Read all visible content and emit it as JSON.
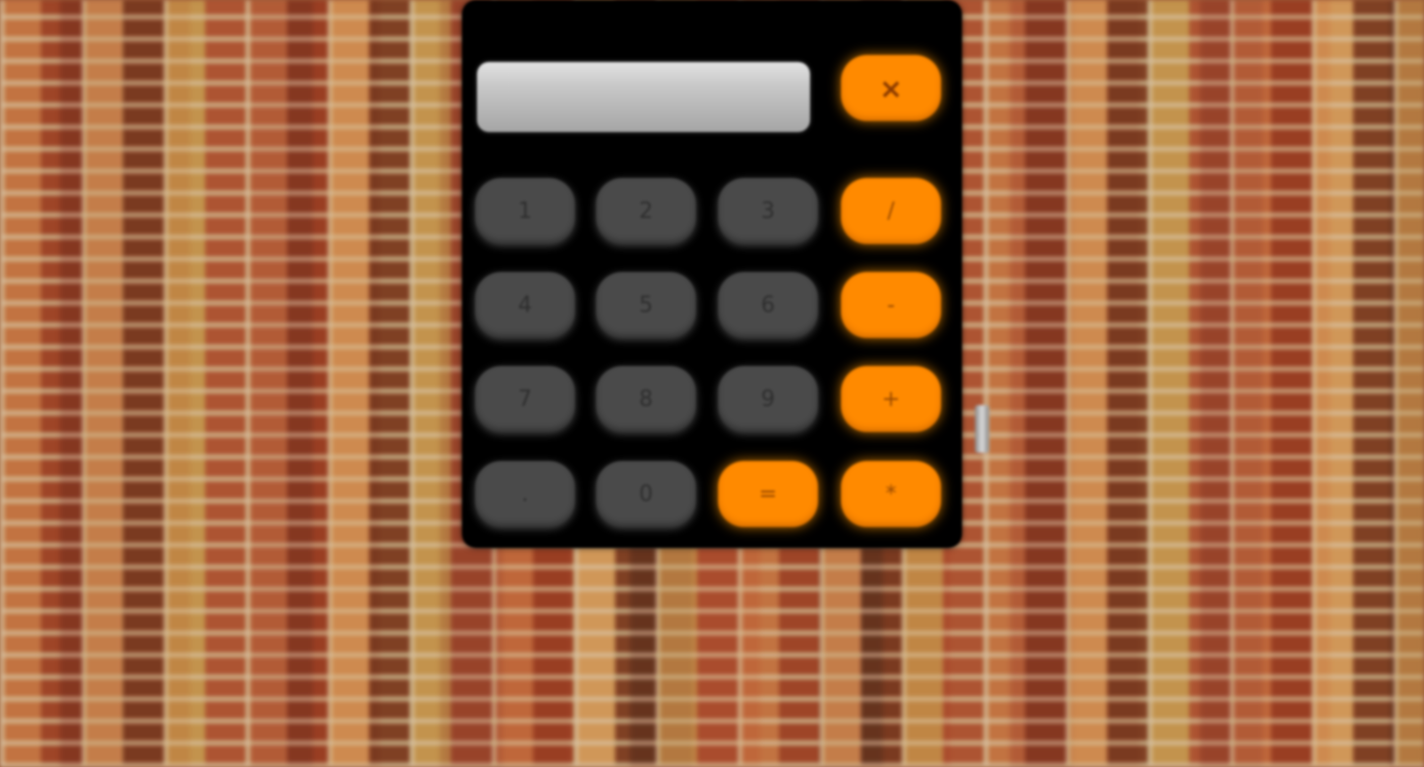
{
  "calculator": {
    "display_value": "",
    "clear_label": "×",
    "keys": {
      "k1": "1",
      "k2": "2",
      "k3": "3",
      "divide": "/",
      "k4": "4",
      "k5": "5",
      "k6": "6",
      "minus": "-",
      "k7": "7",
      "k8": "8",
      "k9": "9",
      "plus": "+",
      "decimal": ".",
      "k0": "0",
      "equals": "=",
      "multiply": "*"
    }
  },
  "colors": {
    "operator_key": "#ff8a00",
    "number_key": "#4a4a4a",
    "body": "#000000",
    "display": "#c7c7c7"
  }
}
